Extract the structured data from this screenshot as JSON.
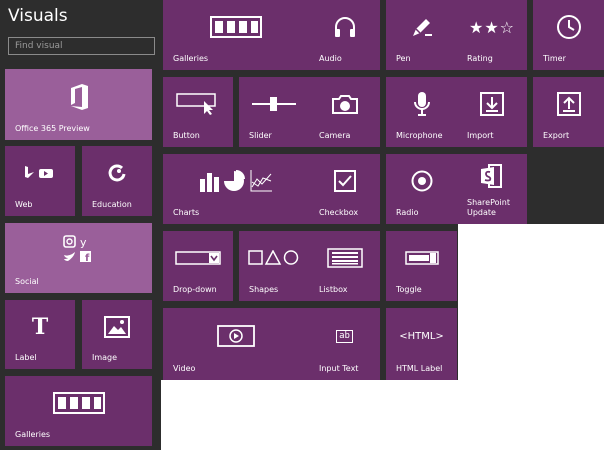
{
  "panel": {
    "title": "Visuals",
    "search_placeholder": "Find visual"
  },
  "left_tiles": {
    "office365": "Office 365 Preview",
    "web": "Web",
    "education": "Education",
    "social": "Social",
    "label": "Label",
    "image": "Image",
    "galleries": "Galleries"
  },
  "tiles": {
    "galleries": "Galleries",
    "audio": "Audio",
    "pen": "Pen",
    "rating": "Rating",
    "timer": "Timer",
    "button": "Button",
    "slider": "Slider",
    "camera": "Camera",
    "microphone": "Microphone",
    "import": "Import",
    "export": "Export",
    "charts": "Charts",
    "checkbox": "Checkbox",
    "radio": "Radio",
    "sharepoint_update": "SharePoint Update",
    "dropdown": "Drop-down",
    "shapes": "Shapes",
    "listbox": "Listbox",
    "toggle": "Toggle",
    "video": "Video",
    "input_text": "Input Text",
    "html_label": "HTML Label"
  },
  "glyphs": {
    "label_t": "T",
    "ab": "ab",
    "html_tag": "<HTML>",
    "social_y": "y",
    "social_f": "f",
    "rating_stars": "★★☆"
  },
  "colors": {
    "tile": "#6b2f6b",
    "tile_light": "#9a5f9a",
    "background_dark": "#2d2d2d"
  }
}
